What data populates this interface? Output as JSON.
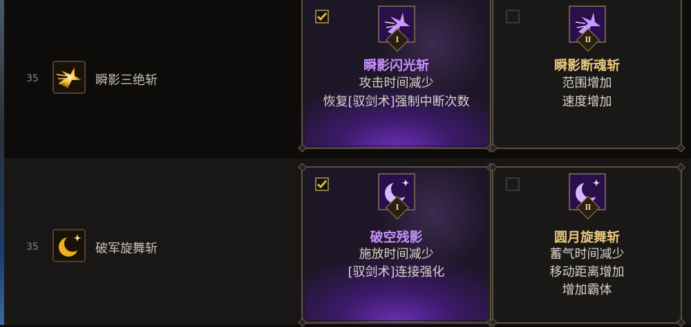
{
  "skills": [
    {
      "level": "35",
      "name": "瞬影三绝斩",
      "icon": "winged-slash-icon",
      "options": [
        {
          "numeral": "Ⅰ",
          "title": "瞬影闪光斩",
          "lines": [
            "攻击时间减少",
            "恢复[驭剑术]强制中断次数"
          ],
          "checked": true
        },
        {
          "numeral": "Ⅱ",
          "title": "瞬影断魂斩",
          "lines": [
            "范围增加",
            "速度增加"
          ],
          "checked": false
        }
      ]
    },
    {
      "level": "35",
      "name": "破军旋舞斩",
      "icon": "crescent-moon-icon",
      "options": [
        {
          "numeral": "Ⅰ",
          "title": "破空残影",
          "lines": [
            "施放时间减少",
            "[驭剑术]连接强化"
          ],
          "checked": true
        },
        {
          "numeral": "Ⅱ",
          "title": "圆月旋舞斩",
          "lines": [
            "蓄气时间减少",
            "移动距离增加",
            "增加霸体"
          ],
          "checked": false
        }
      ]
    }
  ],
  "colors": {
    "selected_title": "#c790ff",
    "unselected_title": "#e9c77e",
    "checkbox_check": "#e8b53a",
    "card_border": "#5c5242"
  }
}
